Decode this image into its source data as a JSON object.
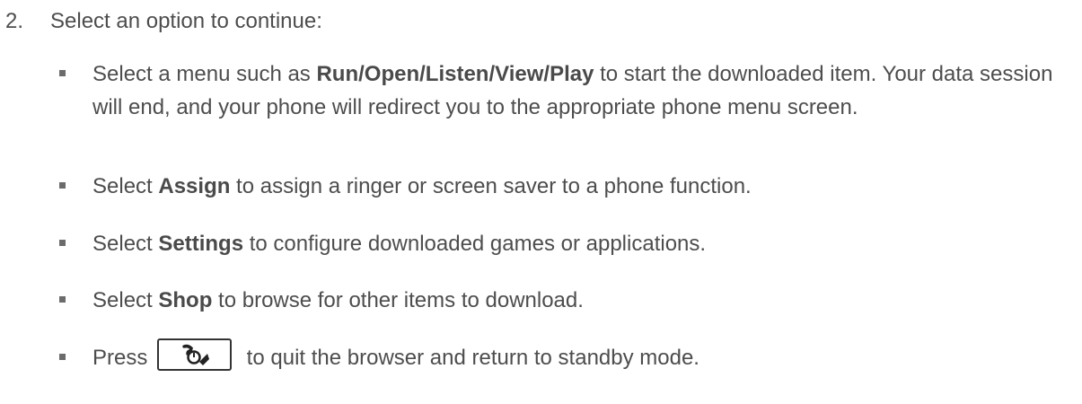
{
  "step": {
    "number": "2.",
    "text": "Select an option to continue:"
  },
  "bullets": [
    {
      "pre": "Select a menu such as ",
      "bold": "Run/Open/Listen/View/Play",
      "post": " to start the downloaded item. Your data session will end, and your phone will redirect you to the appropriate phone menu screen."
    },
    {
      "pre": "Select ",
      "bold": "Assign",
      "post": " to assign a ringer or screen saver to a phone function."
    },
    {
      "pre": "Select ",
      "bold": "Settings",
      "post": " to configure downloaded games or applications."
    },
    {
      "pre": "Select ",
      "bold": "Shop",
      "post": " to browse for other items to download."
    },
    {
      "pre": "Press ",
      "key_icon": "end-call-key-icon",
      "post": " to quit the browser and return to standby mode."
    }
  ]
}
